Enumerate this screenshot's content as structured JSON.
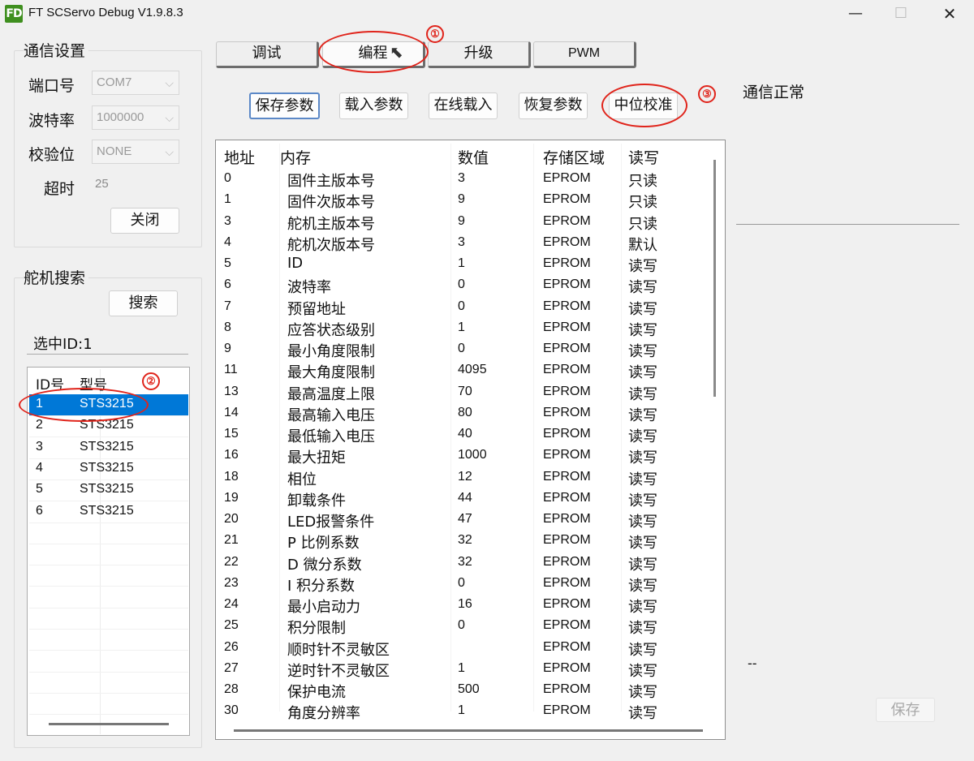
{
  "window": {
    "logo": "FD",
    "title": "FT SCServo Debug V1.9.8.3",
    "minimize": "—",
    "maximize": "☐",
    "close": "✕"
  },
  "comm": {
    "group_label": "通信设置",
    "port_label": "端口号",
    "port_value": "COM7",
    "baud_label": "波特率",
    "baud_value": "1000000",
    "parity_label": "校验位",
    "parity_value": "NONE",
    "timeout_label": "超时",
    "timeout_value": "25",
    "close_button": "关闭"
  },
  "search": {
    "group_label": "舵机搜索",
    "search_button": "搜索",
    "selected_label": "选中ID:1",
    "columns": [
      "ID号",
      "型号"
    ],
    "rows": [
      {
        "id": "1",
        "model": "STS3215"
      },
      {
        "id": "2",
        "model": "STS3215"
      },
      {
        "id": "3",
        "model": "STS3215"
      },
      {
        "id": "4",
        "model": "STS3215"
      },
      {
        "id": "5",
        "model": "STS3215"
      },
      {
        "id": "6",
        "model": "STS3215"
      }
    ]
  },
  "tabs": [
    "调试",
    "编程",
    "升级",
    "PWM"
  ],
  "actions": [
    "保存参数",
    "载入参数",
    "在线载入",
    "恢复参数",
    "中位校准"
  ],
  "table": {
    "columns": [
      "地址",
      "内存",
      "数值",
      "存储区域",
      "读写"
    ],
    "rows": [
      {
        "addr": "0",
        "name": "固件主版本号",
        "value": "3",
        "area": "EPROM",
        "rw": "只读"
      },
      {
        "addr": "1",
        "name": "固件次版本号",
        "value": "9",
        "area": "EPROM",
        "rw": "只读"
      },
      {
        "addr": "3",
        "name": "舵机主版本号",
        "value": "9",
        "area": "EPROM",
        "rw": "只读"
      },
      {
        "addr": "4",
        "name": "舵机次版本号",
        "value": "3",
        "area": "EPROM",
        "rw": "默认"
      },
      {
        "addr": "5",
        "name": "ID",
        "value": "1",
        "area": "EPROM",
        "rw": "读写"
      },
      {
        "addr": "6",
        "name": "波特率",
        "value": "0",
        "area": "EPROM",
        "rw": "读写"
      },
      {
        "addr": "7",
        "name": "预留地址",
        "value": "0",
        "area": "EPROM",
        "rw": "读写"
      },
      {
        "addr": "8",
        "name": "应答状态级别",
        "value": "1",
        "area": "EPROM",
        "rw": "读写"
      },
      {
        "addr": "9",
        "name": "最小角度限制",
        "value": "0",
        "area": "EPROM",
        "rw": "读写"
      },
      {
        "addr": "11",
        "name": "最大角度限制",
        "value": "4095",
        "area": "EPROM",
        "rw": "读写"
      },
      {
        "addr": "13",
        "name": "最高温度上限",
        "value": "70",
        "area": "EPROM",
        "rw": "读写"
      },
      {
        "addr": "14",
        "name": "最高输入电压",
        "value": "80",
        "area": "EPROM",
        "rw": "读写"
      },
      {
        "addr": "15",
        "name": "最低输入电压",
        "value": "40",
        "area": "EPROM",
        "rw": "读写"
      },
      {
        "addr": "16",
        "name": "最大扭矩",
        "value": "1000",
        "area": "EPROM",
        "rw": "读写"
      },
      {
        "addr": "18",
        "name": "相位",
        "value": "12",
        "area": "EPROM",
        "rw": "读写"
      },
      {
        "addr": "19",
        "name": "卸载条件",
        "value": "44",
        "area": "EPROM",
        "rw": "读写"
      },
      {
        "addr": "20",
        "name": "LED报警条件",
        "value": "47",
        "area": "EPROM",
        "rw": "读写"
      },
      {
        "addr": "21",
        "name": "P 比例系数",
        "value": "32",
        "area": "EPROM",
        "rw": "读写"
      },
      {
        "addr": "22",
        "name": "D 微分系数",
        "value": "32",
        "area": "EPROM",
        "rw": "读写"
      },
      {
        "addr": "23",
        "name": "I 积分系数",
        "value": "0",
        "area": "EPROM",
        "rw": "读写"
      },
      {
        "addr": "24",
        "name": "最小启动力",
        "value": "16",
        "area": "EPROM",
        "rw": "读写"
      },
      {
        "addr": "25",
        "name": "积分限制",
        "value": "0",
        "area": "EPROM",
        "rw": "读写"
      },
      {
        "addr": "26",
        "name": "顺时针不灵敏区",
        "value": "",
        "area": "EPROM",
        "rw": "读写"
      },
      {
        "addr": "27",
        "name": "逆时针不灵敏区",
        "value": "1",
        "area": "EPROM",
        "rw": "读写"
      },
      {
        "addr": "28",
        "name": "保护电流",
        "value": "500",
        "area": "EPROM",
        "rw": "读写"
      },
      {
        "addr": "30",
        "name": "角度分辨率",
        "value": "1",
        "area": "EPROM",
        "rw": "读写"
      }
    ]
  },
  "status": {
    "text": "通信正常",
    "dash": "--",
    "save_button": "保存"
  },
  "annotations": [
    "①",
    "②",
    "③"
  ],
  "colors": {
    "selection": "#0078d7",
    "annotation": "#e0241b",
    "logo": "#3f8f1f"
  }
}
